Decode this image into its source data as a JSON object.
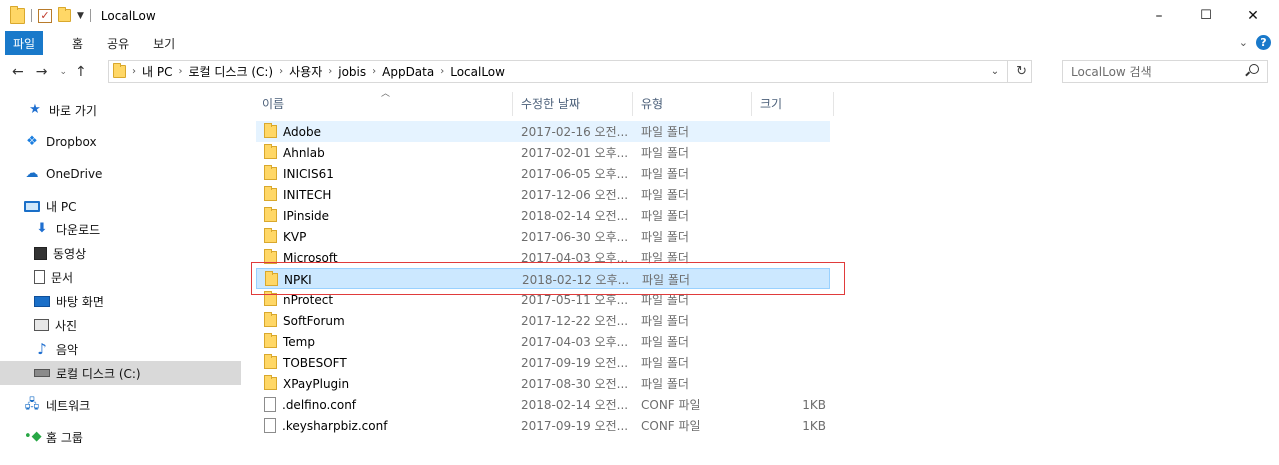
{
  "window": {
    "title": "LocalLow",
    "controls": {
      "minimize": "–",
      "maximize": "☐",
      "close": "✕"
    }
  },
  "ribbon": {
    "file_tab": "파일",
    "tabs": [
      "홈",
      "공유",
      "보기"
    ],
    "help": "?",
    "expand": "⌄"
  },
  "nav": {
    "back": "←",
    "forward": "→",
    "recent": "⌄",
    "up": "↑",
    "breadcrumbs": [
      "내 PC",
      "로컬 디스크 (C:)",
      "사용자",
      "jobis",
      "AppData",
      "LocalLow"
    ],
    "refresh": "↻",
    "dropdown": "⌄",
    "search_placeholder": "LocalLow 검색"
  },
  "navpane": [
    {
      "label": "바로 가기",
      "icon": "star-icon"
    },
    {
      "label": "Dropbox",
      "icon": "dropbox-icon"
    },
    {
      "label": "OneDrive",
      "icon": "cloud-icon"
    },
    {
      "label": "내 PC",
      "icon": "pc-icon"
    },
    {
      "label": "다운로드",
      "icon": "download-icon"
    },
    {
      "label": "동영상",
      "icon": "video-icon"
    },
    {
      "label": "문서",
      "icon": "document-icon"
    },
    {
      "label": "바탕 화면",
      "icon": "desktop-icon"
    },
    {
      "label": "사진",
      "icon": "picture-icon"
    },
    {
      "label": "음악",
      "icon": "music-icon"
    },
    {
      "label": "로컬 디스크 (C:)",
      "icon": "disk-icon",
      "selected": true
    },
    {
      "label": "네트워크",
      "icon": "network-icon"
    },
    {
      "label": "홈 그룹",
      "icon": "homegroup-icon"
    }
  ],
  "columns": {
    "name": "이름",
    "date": "수정한 날짜",
    "type": "유형",
    "size": "크기"
  },
  "files": [
    {
      "name": "Adobe",
      "date": "2017-02-16 오전...",
      "type": "파일 폴더",
      "size": "",
      "kind": "folder",
      "state": "hover"
    },
    {
      "name": "Ahnlab",
      "date": "2017-02-01 오후...",
      "type": "파일 폴더",
      "size": "",
      "kind": "folder"
    },
    {
      "name": "INICIS61",
      "date": "2017-06-05 오후...",
      "type": "파일 폴더",
      "size": "",
      "kind": "folder"
    },
    {
      "name": "INITECH",
      "date": "2017-12-06 오전...",
      "type": "파일 폴더",
      "size": "",
      "kind": "folder"
    },
    {
      "name": "IPinside",
      "date": "2018-02-14 오전...",
      "type": "파일 폴더",
      "size": "",
      "kind": "folder"
    },
    {
      "name": "KVP",
      "date": "2017-06-30 오후...",
      "type": "파일 폴더",
      "size": "",
      "kind": "folder"
    },
    {
      "name": "Microsoft",
      "date": "2017-04-03 오후...",
      "type": "파일 폴더",
      "size": "",
      "kind": "folder"
    },
    {
      "name": "NPKI",
      "date": "2018-02-12 오후...",
      "type": "파일 폴더",
      "size": "",
      "kind": "folder",
      "state": "selected"
    },
    {
      "name": "nProtect",
      "date": "2017-05-11 오후...",
      "type": "파일 폴더",
      "size": "",
      "kind": "folder"
    },
    {
      "name": "SoftForum",
      "date": "2017-12-22 오전...",
      "type": "파일 폴더",
      "size": "",
      "kind": "folder"
    },
    {
      "name": "Temp",
      "date": "2017-04-03 오후...",
      "type": "파일 폴더",
      "size": "",
      "kind": "folder"
    },
    {
      "name": "TOBESOFT",
      "date": "2017-09-19 오전...",
      "type": "파일 폴더",
      "size": "",
      "kind": "folder"
    },
    {
      "name": "XPayPlugin",
      "date": "2017-08-30 오전...",
      "type": "파일 폴더",
      "size": "",
      "kind": "folder"
    },
    {
      "name": ".delfino.conf",
      "date": "2018-02-14 오전...",
      "type": "CONF 파일",
      "size": "1KB",
      "kind": "file"
    },
    {
      "name": ".keysharpbiz.conf",
      "date": "2017-09-19 오전...",
      "type": "CONF 파일",
      "size": "1KB",
      "kind": "file"
    }
  ],
  "colors": {
    "accent": "#1979ca",
    "selection": "#cce8ff",
    "highlight_box": "#e03b3b"
  }
}
